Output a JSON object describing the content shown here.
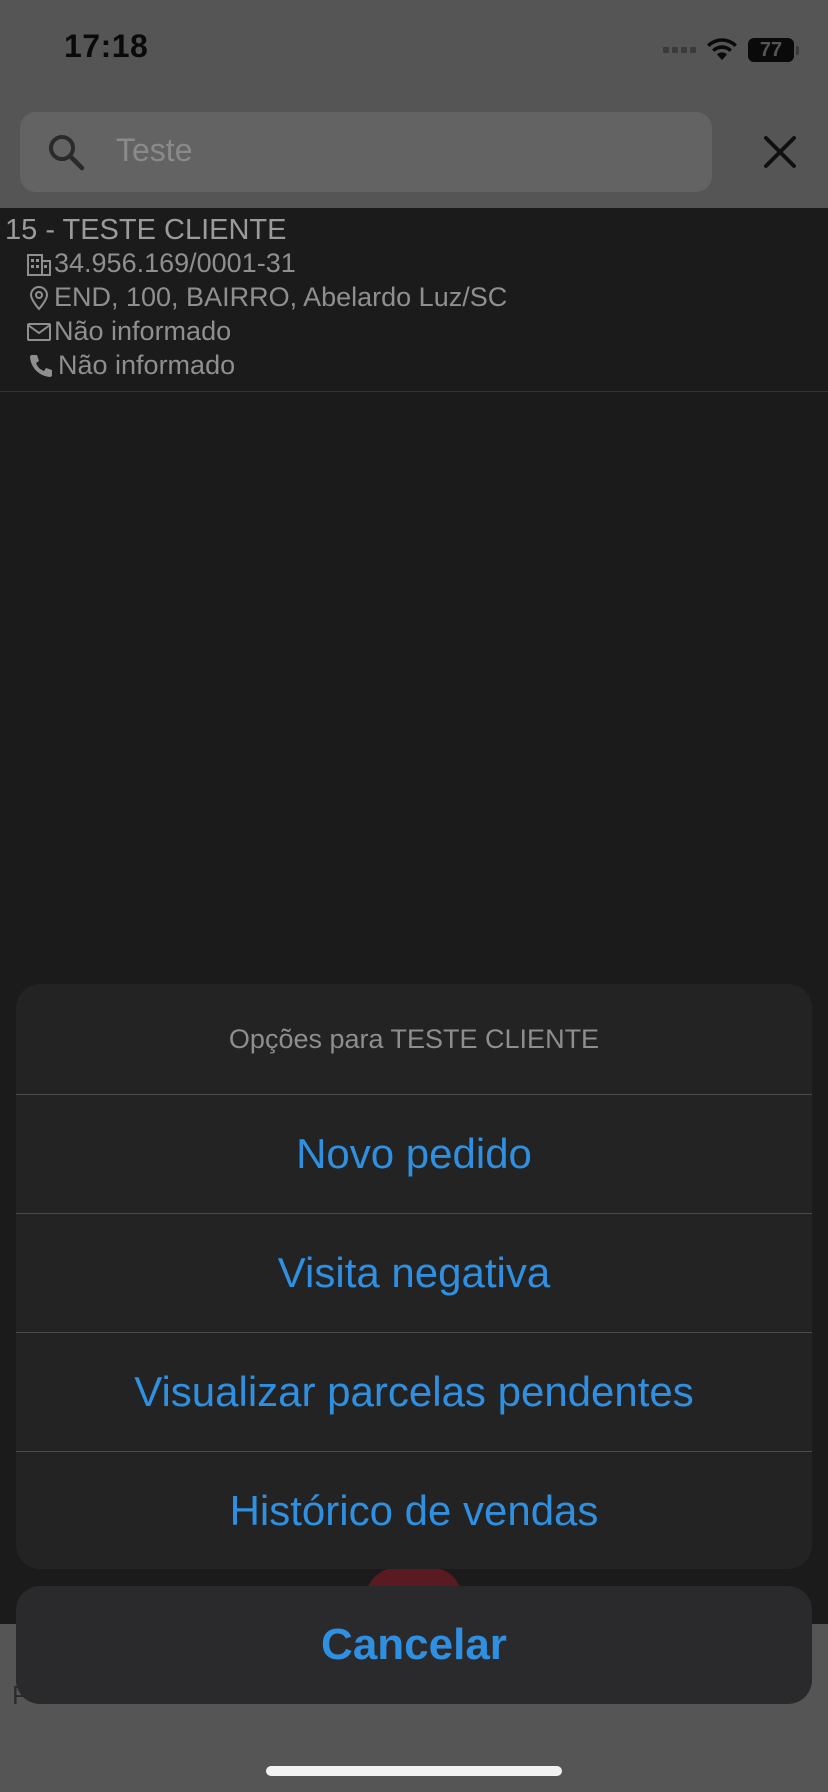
{
  "status_bar": {
    "time": "17:18",
    "battery": "77"
  },
  "search": {
    "value": "Teste"
  },
  "client": {
    "title": "15 - TESTE CLIENTE",
    "document": "34.956.169/0001-31",
    "address": "END, 100, BAIRRO, Abelardo Luz/SC",
    "email": "Não informado",
    "phone": "Não informado"
  },
  "action_sheet": {
    "title": "Opções para TESTE CLIENTE",
    "options": [
      {
        "label": "Novo pedido"
      },
      {
        "label": "Visita negativa"
      },
      {
        "label": "Visualizar parcelas pendentes"
      },
      {
        "label": "Histórico de vendas"
      }
    ],
    "cancel_label": "Cancelar"
  },
  "bottom_bar": {
    "partial_text": "P"
  },
  "colors": {
    "accent": "#2f8fe0",
    "overlay_dim": "#555555",
    "sheet_bg": "#232323"
  }
}
